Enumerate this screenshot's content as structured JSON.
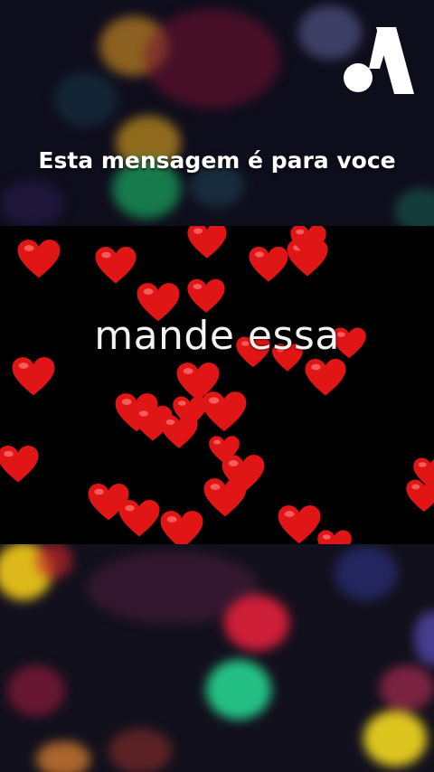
{
  "caption": {
    "text": "Esta mensagem é para voce"
  },
  "video": {
    "overlay_text": "mande essa"
  },
  "logo": {
    "icon": "a-letter-logo-icon",
    "color": "#ffffff"
  },
  "colors": {
    "heart": "#e01515",
    "panel_background": "#000000",
    "caption_text": "#ffffff"
  }
}
